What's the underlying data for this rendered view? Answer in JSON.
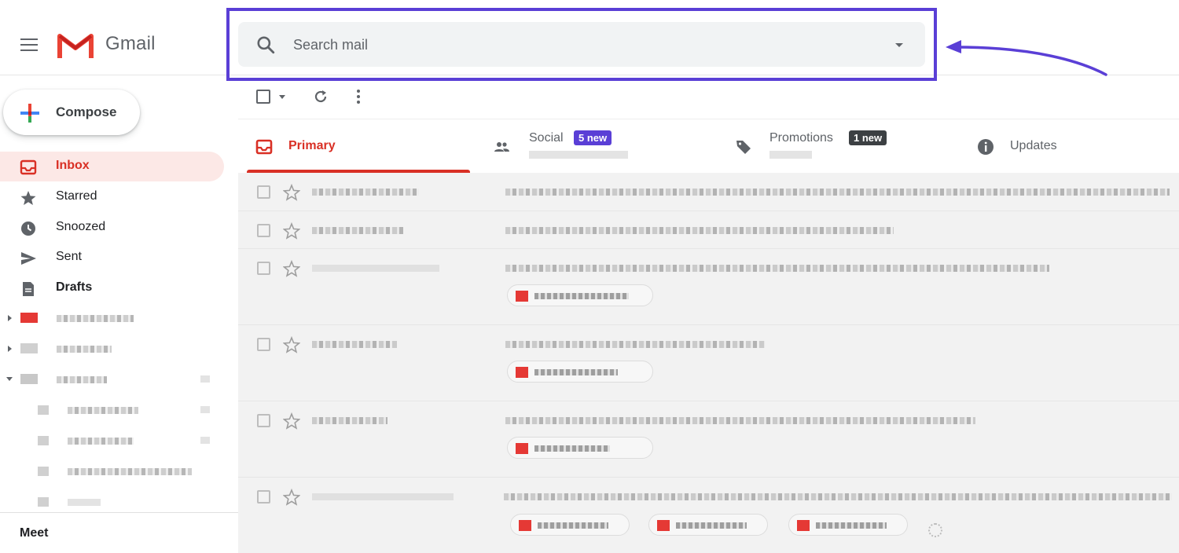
{
  "header": {
    "app_name": "Gmail",
    "search_placeholder": "Search mail"
  },
  "sidebar": {
    "compose_label": "Compose",
    "items": [
      {
        "label": "Inbox",
        "icon": "inbox-icon",
        "active": true
      },
      {
        "label": "Starred",
        "icon": "star-icon"
      },
      {
        "label": "Snoozed",
        "icon": "clock-icon"
      },
      {
        "label": "Sent",
        "icon": "send-icon"
      },
      {
        "label": "Drafts",
        "icon": "draft-icon"
      }
    ],
    "meet_label": "Meet"
  },
  "tabs": [
    {
      "label": "Primary",
      "icon": "inbox-icon"
    },
    {
      "label": "Social",
      "icon": "people-icon",
      "badge": "5 new"
    },
    {
      "label": "Promotions",
      "icon": "tag-icon",
      "badge": "1 new"
    },
    {
      "label": "Updates",
      "icon": "info-icon"
    }
  ],
  "colors": {
    "accent_red": "#d93025",
    "annotation_purple": "#5a3fd6",
    "promo_badge": "#3c4043"
  }
}
